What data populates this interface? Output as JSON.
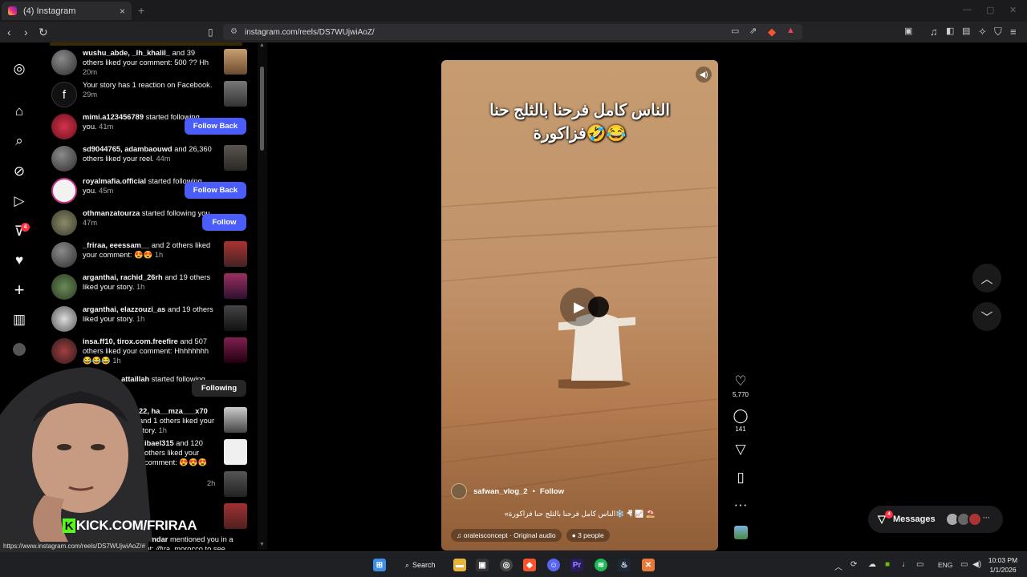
{
  "browser": {
    "tab_title": "(4) Instagram",
    "tab_close": "×",
    "new_tab": "+",
    "url": "instagram.com/reels/DS7WUjwiAoZ/",
    "status_url": "https://www.instagram.com/reels/DS7WUjwiAoZ/#"
  },
  "sidebar": {
    "notifications_badge": "4"
  },
  "notifications": [
    {
      "user": "wushu_abde, _lh_khalil_",
      "text": " and 39 others liked your comment: 500 ?? Hh ",
      "time": "20m",
      "action": "thumb"
    },
    {
      "user": "",
      "text": "Your story has 1 reaction on Facebook. ",
      "time": "29m",
      "action": "thumb"
    },
    {
      "user": "mimi.a123456789",
      "text": " started following you. ",
      "time": "41m",
      "action": "Follow Back"
    },
    {
      "user": "sd9044765, adambaouwd",
      "text": " and 26,360 others liked your reel. ",
      "time": "44m",
      "action": "thumb"
    },
    {
      "user": "royalmafia.official",
      "text": " started following you. ",
      "time": "45m",
      "action": "Follow Back"
    },
    {
      "user": "othmanzatourza",
      "text": " started following you. ",
      "time": "47m",
      "action": "Follow"
    },
    {
      "user": "_friraa, eeessam__",
      "text": " and 2 others liked your comment: 😍😍 ",
      "time": "1h",
      "action": "thumb"
    },
    {
      "user": "arganthai, rachid_26rh",
      "text": " and 19 others liked your story. ",
      "time": "1h",
      "action": "thumb"
    },
    {
      "user": "arganthai, elazzouzi_as",
      "text": " and 19 others liked your story. ",
      "time": "1h",
      "action": "thumb"
    },
    {
      "user": "insa.ff10, tirox.com.freefire",
      "text": " and 507 others liked your comment: Hhhhhhhh 😂😂😂 ",
      "time": "1h",
      "action": "thumb"
    },
    {
      "user": "ma_zahra_attaillah",
      "text": " started following you. ",
      "time": "1h",
      "action": "Following"
    },
    {
      "user": "22, ha__mza___x70",
      "text": " and 1 others liked your story. ",
      "time": "1h",
      "action": "thumb"
    },
    {
      "user": "ibael315",
      "text": " and 120 others liked your comment: 😍😍😍 ",
      "time": "",
      "action": "thumb"
    },
    {
      "user": "",
      "text": "",
      "time": "2h",
      "action": "thumb"
    },
    {
      "user": "",
      "text": "",
      "time": "",
      "action": "thumb"
    },
    {
      "user": "abdlhhamdar",
      "text": " mentioned you in a comment: @ra_morocco to see",
      "time": "",
      "action": "none"
    }
  ],
  "reel": {
    "caption_line1": "الناس كامل فرحنا بالثلج حنا",
    "caption_line2": "فزاكورة🤣😂",
    "username": "safwan_vlog_2",
    "dot": "•",
    "follow": "Follow",
    "description": "«الناس كامل فرحنا بالثلج حنا فزاكورة❄️ 🤻 📈 ⛱️",
    "audio": "oraleisconcept · Original audio",
    "people": "3 people",
    "likes": "5,770",
    "comments": "141"
  },
  "messages": {
    "label": "Messages",
    "badge": "4",
    "more": "···"
  },
  "overlay": {
    "kick_text": "KICK.COM/FRIRAA",
    "kick_letter": "K"
  },
  "taskbar": {
    "search_label": "Search",
    "lang": "ENG",
    "time": "10:03 PM",
    "date": "1/1/2026"
  },
  "colors": {
    "follow_button": "#4a5df9",
    "badge": "#ff3040",
    "kick_green": "#53fc18"
  }
}
